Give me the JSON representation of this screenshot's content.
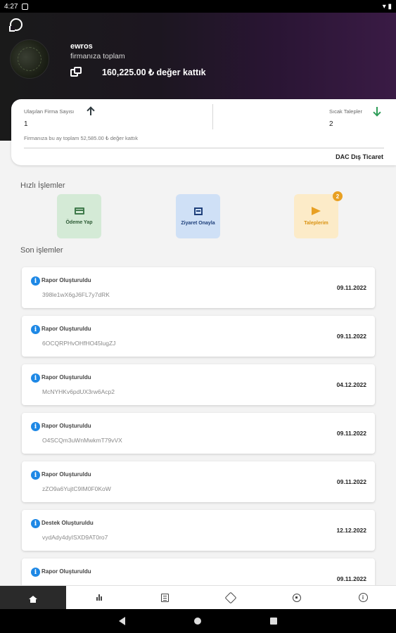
{
  "status_bar": {
    "time": "4:27"
  },
  "header": {
    "company_name": "ewros",
    "subtitle": "firmanıza toplam",
    "total": "160,225.00 ₺ değer kattık"
  },
  "stats": {
    "left_label": "Ulaşılan Firma Sayısı",
    "left_value": "1",
    "right_label": "Sıcak Talepler",
    "right_value": "2",
    "month_text": "Firmanıza bu ay toplam 52,585.00 ₺ değer kattık",
    "company": "DAC Dış Ticaret"
  },
  "quick_actions": {
    "title": "Hızlı İşlemler",
    "pay_label": "Ödeme Yap",
    "visit_label": "Ziyaret Onayla",
    "requests_label": "Taleplerim",
    "requests_badge": "2"
  },
  "recent": {
    "title": "Son işlemler",
    "items": [
      {
        "title": "Rapor Oluşturuldu",
        "code": "398le1wX6gJ6FL7y7dRK",
        "date": "09.11.2022"
      },
      {
        "title": "Rapor Oluşturuldu",
        "code": "6OCQRPHvOHfHO45lugZJ",
        "date": "09.11.2022"
      },
      {
        "title": "Rapor Oluşturuldu",
        "code": "McNYHKv6pdUX3rw6Acp2",
        "date": "04.12.2022"
      },
      {
        "title": "Rapor Oluşturuldu",
        "code": "O4SCQm3uWnMwkmT79vVX",
        "date": "09.11.2022"
      },
      {
        "title": "Rapor Oluşturuldu",
        "code": "zZO9a6YujtC9IM0F0KoW",
        "date": "09.11.2022"
      },
      {
        "title": "Destek Oluşturuldu",
        "code": "vydAdy4dyISXD9AT0ro7",
        "date": "12.12.2022"
      },
      {
        "title": "Rapor Oluşturuldu",
        "code": "",
        "date": "09.11.2022"
      }
    ]
  },
  "nav": {
    "active": "home"
  },
  "icons": {
    "whatsapp": "whatsapp-icon",
    "copy": "copy-icon",
    "arrow_up": "arrow-up-icon",
    "arrow_down": "arrow-down-icon",
    "info": "info-icon"
  }
}
